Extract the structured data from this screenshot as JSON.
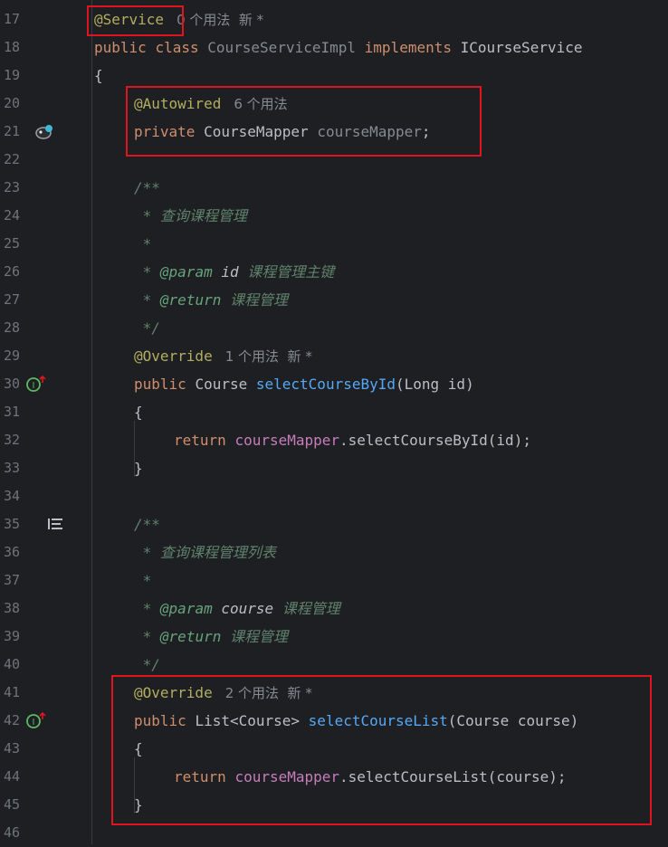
{
  "lines": [
    {
      "n": "17"
    },
    {
      "n": "18"
    },
    {
      "n": "19"
    },
    {
      "n": "20"
    },
    {
      "n": "21"
    },
    {
      "n": "22"
    },
    {
      "n": "23"
    },
    {
      "n": "24"
    },
    {
      "n": "25"
    },
    {
      "n": "26"
    },
    {
      "n": "27"
    },
    {
      "n": "28"
    },
    {
      "n": "29"
    },
    {
      "n": "30"
    },
    {
      "n": "31"
    },
    {
      "n": "32"
    },
    {
      "n": "33"
    },
    {
      "n": "34"
    },
    {
      "n": "35"
    },
    {
      "n": "36"
    },
    {
      "n": "37"
    },
    {
      "n": "38"
    },
    {
      "n": "39"
    },
    {
      "n": "40"
    },
    {
      "n": "41"
    },
    {
      "n": "42"
    },
    {
      "n": "43"
    },
    {
      "n": "44"
    },
    {
      "n": "45"
    },
    {
      "n": "46"
    }
  ],
  "code": {
    "l17": {
      "ann": "@Service",
      "hint": "0 个用法  新 *"
    },
    "l18": {
      "kw1": "public",
      "kw2": "class",
      "cls": "CourseServiceImpl",
      "kw3": "implements",
      "iface": "ICourseService"
    },
    "l19": "{",
    "l20": {
      "ann": "@Autowired",
      "hint": "6 个用法"
    },
    "l21": {
      "kw": "private",
      "type": "CourseMapper",
      "name": "courseMapper",
      "semi": ";"
    },
    "l23": "/**",
    "l24": " * 查询课程管理",
    "l25": " *",
    "l26": {
      "star": " * ",
      "tag": "@param",
      "p": "id",
      "desc": "课程管理主键"
    },
    "l27": {
      "star": " * ",
      "tag": "@return",
      "desc": "课程管理"
    },
    "l28": " */",
    "l29": {
      "ann": "@Override",
      "hint": "1 个用法  新 *"
    },
    "l30": {
      "kw": "public",
      "type": "Course",
      "method": "selectCourseById",
      "params": "(Long id)"
    },
    "l31": "{",
    "l32": {
      "kw": "return",
      "field": "courseMapper",
      "rest": ".selectCourseById(id);"
    },
    "l33": "}",
    "l35": "/**",
    "l36": " * 查询课程管理列表",
    "l37": " *",
    "l38": {
      "star": " * ",
      "tag": "@param",
      "p": "course",
      "desc": "课程管理"
    },
    "l39": {
      "star": " * ",
      "tag": "@return",
      "desc": "课程管理"
    },
    "l40": " */",
    "l41": {
      "ann": "@Override",
      "hint": "2 个用法  新 *"
    },
    "l42": {
      "kw": "public",
      "type": "List<Course>",
      "method": "selectCourseList",
      "params": "(Course course)"
    },
    "l43": "{",
    "l44": {
      "kw": "return",
      "field": "courseMapper",
      "rest": ".selectCourseList(course);"
    },
    "l45": "}"
  },
  "colors": {
    "highlight_box": "#e0141e",
    "background": "#1e1f22"
  },
  "icons": {
    "l21": "spring-bean-icon",
    "l30": "implements-method-icon",
    "l35": "doc-render-icon",
    "l42": "implements-method-icon"
  }
}
